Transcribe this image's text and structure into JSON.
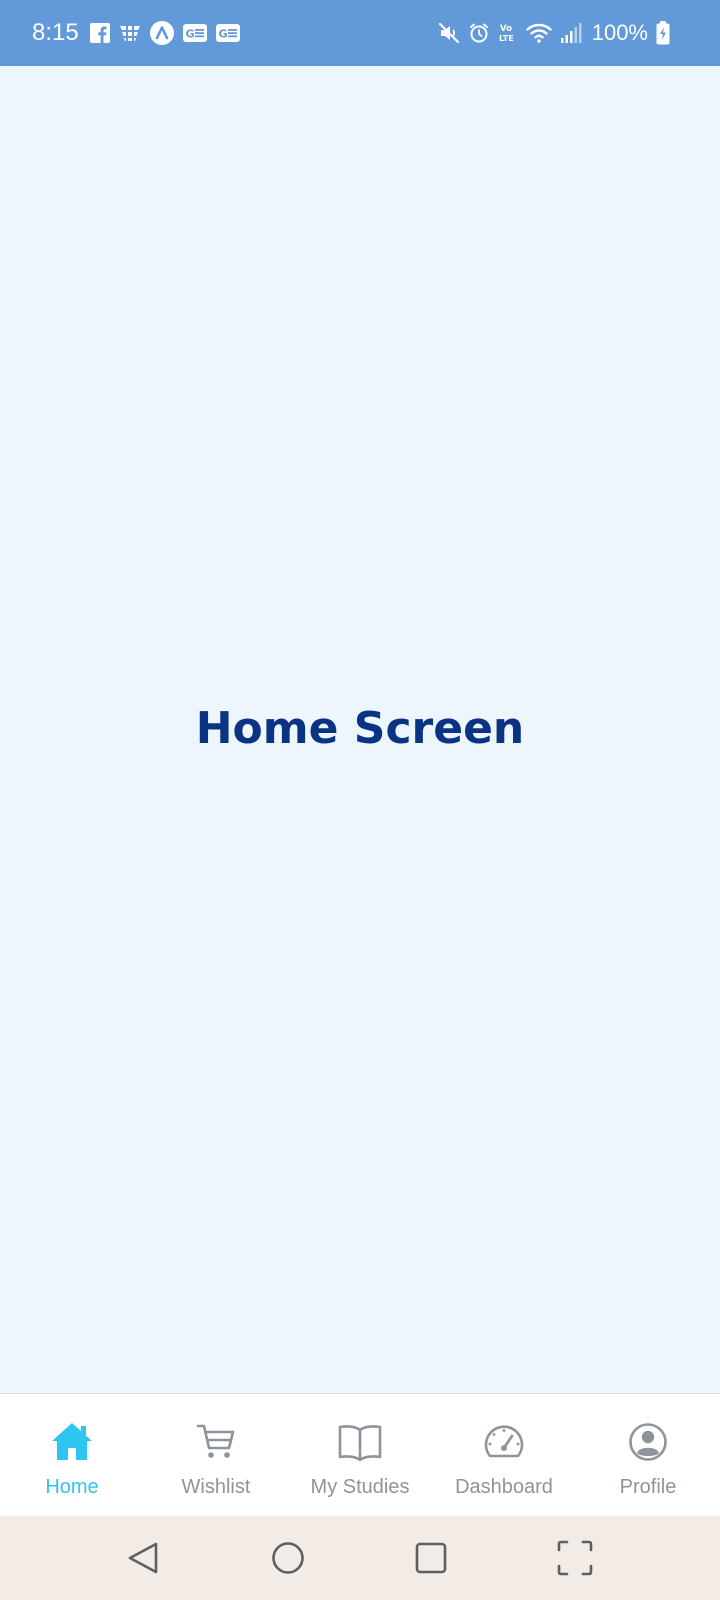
{
  "status_bar": {
    "time": "8:15",
    "battery": "100%",
    "left_icons": [
      "facebook-icon",
      "app-icon",
      "arc-icon",
      "ge-icon",
      "ge-icon"
    ],
    "right_icons": [
      "mute-icon",
      "alarm-icon",
      "volte-icon",
      "wifi-icon",
      "signal-icon",
      "battery-icon"
    ]
  },
  "main": {
    "title": "Home Screen"
  },
  "bottom_nav": {
    "items": [
      {
        "label": "Home",
        "icon": "home-icon",
        "active": true
      },
      {
        "label": "Wishlist",
        "icon": "cart-icon",
        "active": false
      },
      {
        "label": "My Studies",
        "icon": "book-icon",
        "active": false
      },
      {
        "label": "Dashboard",
        "icon": "speedometer-icon",
        "active": false
      },
      {
        "label": "Profile",
        "icon": "user-circle-icon",
        "active": false
      }
    ]
  },
  "system_nav": {
    "buttons": [
      "back-icon",
      "home-circle-icon",
      "recents-icon",
      "screenshot-icon"
    ]
  },
  "colors": {
    "status_bar": "#6299d9",
    "background": "#edf5fd",
    "title": "#0b3384",
    "active": "#2ec5f0",
    "inactive": "#8e949c",
    "system_nav": "#f3ebe6"
  }
}
